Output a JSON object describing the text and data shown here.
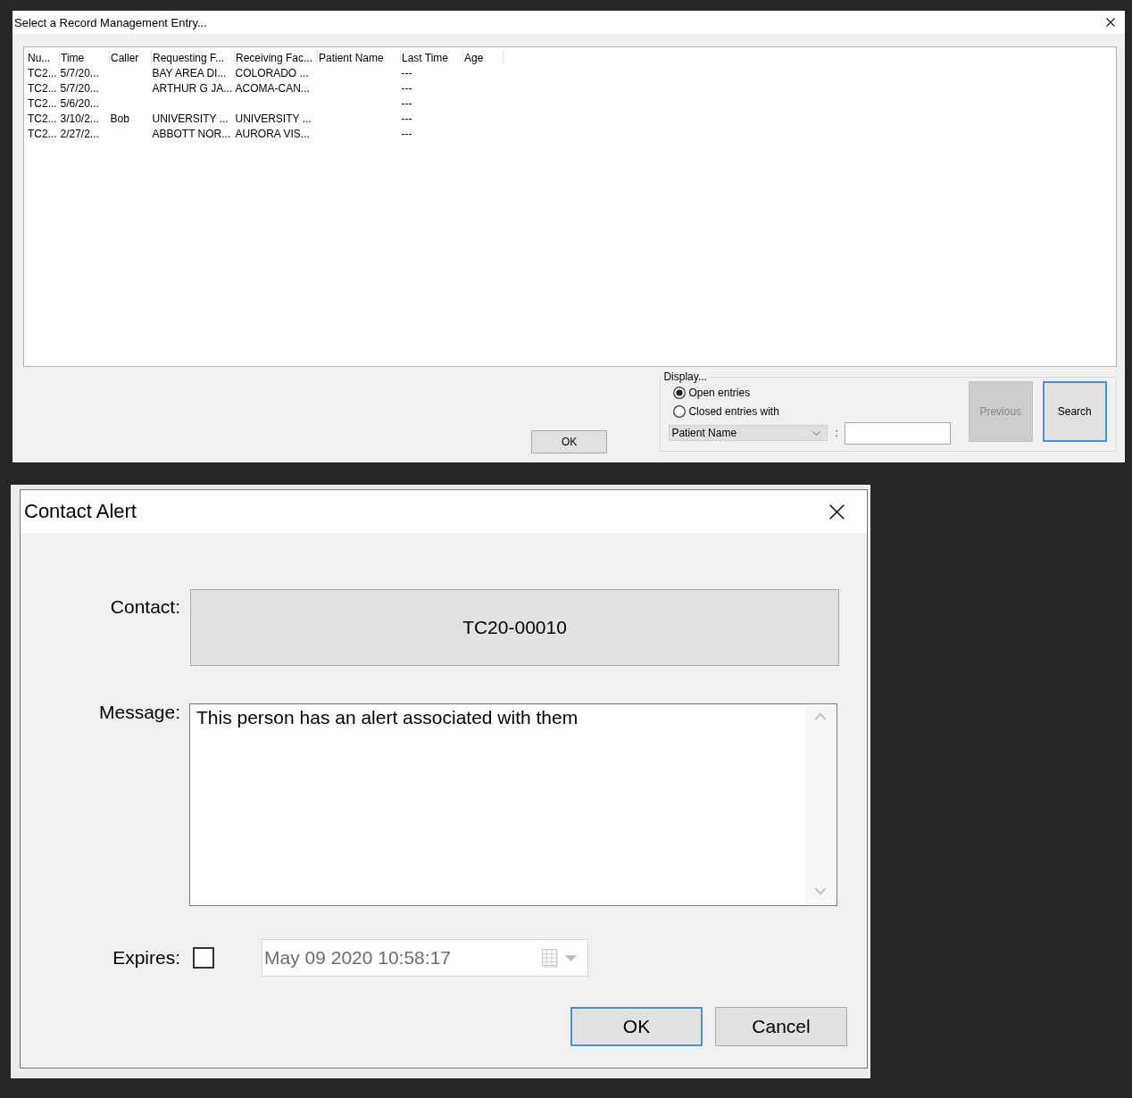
{
  "record_dialog": {
    "title": "Select a Record Management Entry...",
    "table": {
      "columns": [
        "Nu...",
        "Time",
        "Caller",
        "Requesting F...",
        "Receiving Fac...",
        "Patient Name",
        "Last Time",
        "Age"
      ],
      "rows": [
        {
          "selected": false,
          "column_1": "TC2...",
          "column_2": "5/7/20...",
          "column_4": "BAY AREA DI...",
          "column_5": "COLORADO ...",
          "column_7": "---"
        },
        {
          "selected": false,
          "column_1": "TC2...",
          "column_2": "5/7/20...",
          "column_4": "ARTHUR G JA...",
          "column_5": "ACOMA-CAN...",
          "column_7": "---"
        },
        {
          "selected": false,
          "column_1": "TC2...",
          "column_2": "5/6/20...",
          "column_7": "---"
        },
        {
          "selected": false,
          "column_1": "TC2...",
          "column_2": "3/10/2...",
          "column_3": "Bob",
          "column_4": "UNIVERSITY ...",
          "column_5": "UNIVERSITY ...",
          "column_7": "---"
        },
        {
          "selected": false,
          "column_1": "TC2...",
          "column_2": "2/27/2...",
          "column_4": "ABBOTT NOR...",
          "column_5": "AURORA VIS...",
          "column_7": "---"
        }
      ]
    },
    "ok_button": {
      "label": "OK"
    },
    "display": {
      "label": "Display...",
      "options": [
        {
          "label": "Open entries",
          "selected": true
        },
        {
          "label": "Closed entries with",
          "selected": false
        }
      ],
      "filter_dropdown": {
        "value": "Patient Name"
      },
      "separator": ":",
      "buttons": [
        {
          "label": "Previous",
          "disabled": true,
          "focused": false
        },
        {
          "label": "Search",
          "disabled": false,
          "focused": true
        }
      ]
    }
  },
  "contact_alert": {
    "title": "Contact Alert",
    "contact": {
      "label": "Contact:",
      "value": "TC20-00010"
    },
    "message": {
      "label": "Message:",
      "value": "This person has an alert associated with them"
    },
    "expires": {
      "label": "Expires:",
      "checked": false,
      "date": "May 09 2020 10:58:17",
      "disabled": true
    },
    "buttons": [
      {
        "label": "OK",
        "focused": true
      },
      {
        "label": "Cancel",
        "focused": false
      }
    ]
  }
}
